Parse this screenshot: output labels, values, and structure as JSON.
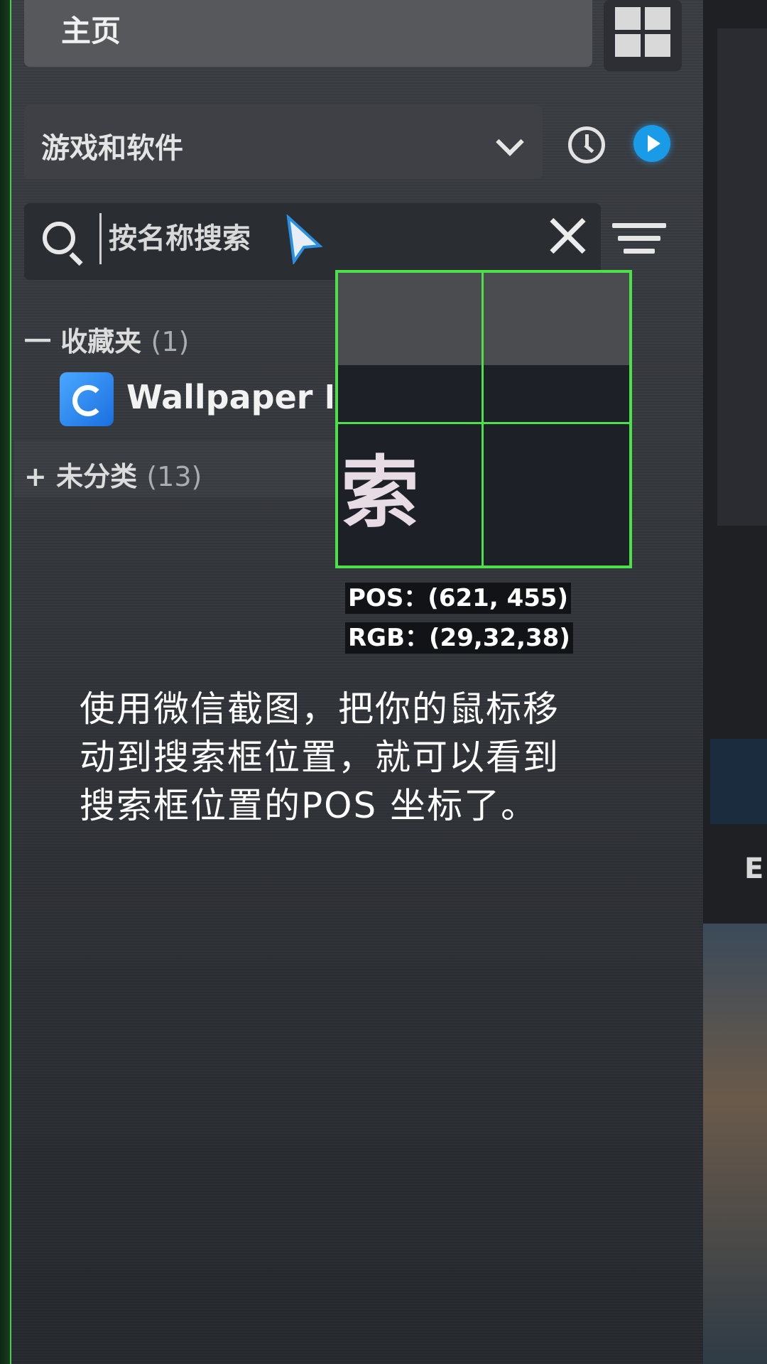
{
  "nav": {
    "home_label": "主页",
    "grid_icon": "grid-view-icon"
  },
  "category": {
    "selected": "游戏和软件",
    "chevron_icon": "chevron-down-icon",
    "history_icon": "clock-icon",
    "play_icon": "play-icon"
  },
  "search": {
    "placeholder": "按名称搜索",
    "icon": "search-icon",
    "clear_icon": "close-icon",
    "filter_icon": "filter-icon"
  },
  "library": {
    "favorites": {
      "prefix": "一",
      "label": "收藏夹",
      "count": "(1)"
    },
    "favorite_item": {
      "title": "Wallpaper Eng"
    },
    "uncategorized": {
      "prefix": "+",
      "label": "未分类",
      "count": "(13)"
    }
  },
  "magnifier": {
    "zoom_char": "索",
    "pos_text": "POS：(621, 455)",
    "rgb_text": "RGB：(29,32,38)",
    "border_color": "#4ee04a"
  },
  "instructions": {
    "line1": "使用微信截图，把你的鼠标移",
    "line2": "动到搜索框位置，就可以看到",
    "line3": "搜索框位置的POS 坐标了。"
  }
}
